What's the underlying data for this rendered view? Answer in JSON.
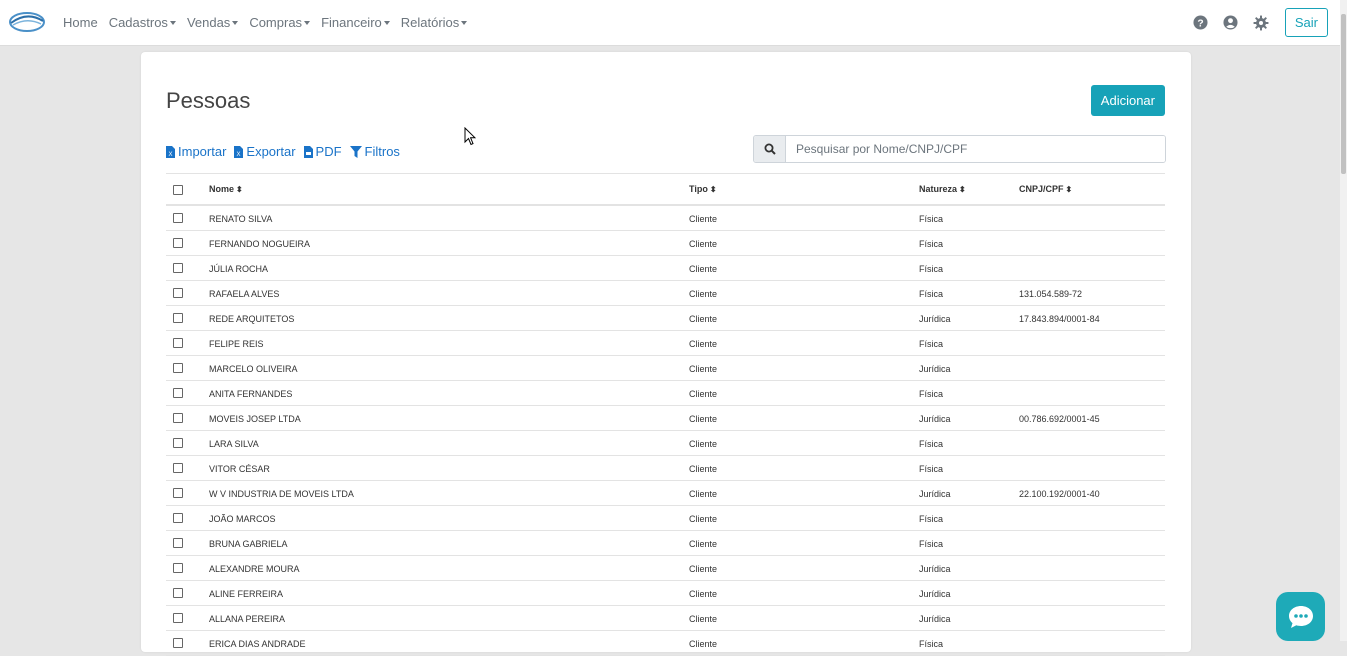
{
  "nav": {
    "items": [
      {
        "label": "Home",
        "dropdown": false
      },
      {
        "label": "Cadastros",
        "dropdown": true
      },
      {
        "label": "Vendas",
        "dropdown": true
      },
      {
        "label": "Compras",
        "dropdown": true
      },
      {
        "label": "Financeiro",
        "dropdown": true
      },
      {
        "label": "Relatórios",
        "dropdown": true
      }
    ],
    "icons": [
      "help-icon",
      "user-icon",
      "gear-icon"
    ],
    "logout_label": "Sair"
  },
  "page": {
    "title": "Pessoas",
    "add_label": "Adicionar",
    "actions": [
      {
        "label": "Importar",
        "icon": "excel-file-icon"
      },
      {
        "label": "Exportar",
        "icon": "excel-file-icon"
      },
      {
        "label": "PDF",
        "icon": "pdf-file-icon"
      },
      {
        "label": "Filtros",
        "icon": "filter-icon"
      }
    ],
    "search_placeholder": "Pesquisar por Nome/CNPJ/CPF"
  },
  "table": {
    "headers": {
      "nome": "Nome",
      "tipo": "Tipo",
      "natureza": "Natureza",
      "cnpj": "CNPJ/CPF"
    },
    "sort_glyph": "⬍",
    "rows": [
      {
        "nome": "RENATO SILVA",
        "tipo": "Cliente",
        "natureza": "Física",
        "cnpj": ""
      },
      {
        "nome": "FERNANDO NOGUEIRA",
        "tipo": "Cliente",
        "natureza": "Física",
        "cnpj": ""
      },
      {
        "nome": "JÚLIA ROCHA",
        "tipo": "Cliente",
        "natureza": "Física",
        "cnpj": ""
      },
      {
        "nome": "RAFAELA ALVES",
        "tipo": "Cliente",
        "natureza": "Física",
        "cnpj": "131.054.589-72"
      },
      {
        "nome": "REDE ARQUITETOS",
        "tipo": "Cliente",
        "natureza": "Jurídica",
        "cnpj": "17.843.894/0001-84"
      },
      {
        "nome": "FELIPE REIS",
        "tipo": "Cliente",
        "natureza": "Física",
        "cnpj": ""
      },
      {
        "nome": "MARCELO OLIVEIRA",
        "tipo": "Cliente",
        "natureza": "Jurídica",
        "cnpj": ""
      },
      {
        "nome": "ANITA FERNANDES",
        "tipo": "Cliente",
        "natureza": "Física",
        "cnpj": ""
      },
      {
        "nome": "MOVEIS JOSEP LTDA",
        "tipo": "Cliente",
        "natureza": "Jurídica",
        "cnpj": "00.786.692/0001-45"
      },
      {
        "nome": "LARA SILVA",
        "tipo": "Cliente",
        "natureza": "Física",
        "cnpj": ""
      },
      {
        "nome": "VITOR CÉSAR",
        "tipo": "Cliente",
        "natureza": "Física",
        "cnpj": ""
      },
      {
        "nome": "W V INDUSTRIA DE MOVEIS LTDA",
        "tipo": "Cliente",
        "natureza": "Jurídica",
        "cnpj": "22.100.192/0001-40"
      },
      {
        "nome": "JOÃO MARCOS",
        "tipo": "Cliente",
        "natureza": "Física",
        "cnpj": ""
      },
      {
        "nome": "BRUNA GABRIELA",
        "tipo": "Cliente",
        "natureza": "Física",
        "cnpj": ""
      },
      {
        "nome": "ALEXANDRE MOURA",
        "tipo": "Cliente",
        "natureza": "Jurídica",
        "cnpj": ""
      },
      {
        "nome": "ALINE FERREIRA",
        "tipo": "Cliente",
        "natureza": "Jurídica",
        "cnpj": ""
      },
      {
        "nome": "ALLANA PEREIRA",
        "tipo": "Cliente",
        "natureza": "Jurídica",
        "cnpj": ""
      },
      {
        "nome": "ERICA DIAS ANDRADE",
        "tipo": "Cliente",
        "natureza": "Física",
        "cnpj": ""
      }
    ]
  },
  "colors": {
    "accent": "#17a2b8",
    "link": "#1a73c8",
    "chat": "#1eaab8",
    "background": "#e6e6e6"
  }
}
